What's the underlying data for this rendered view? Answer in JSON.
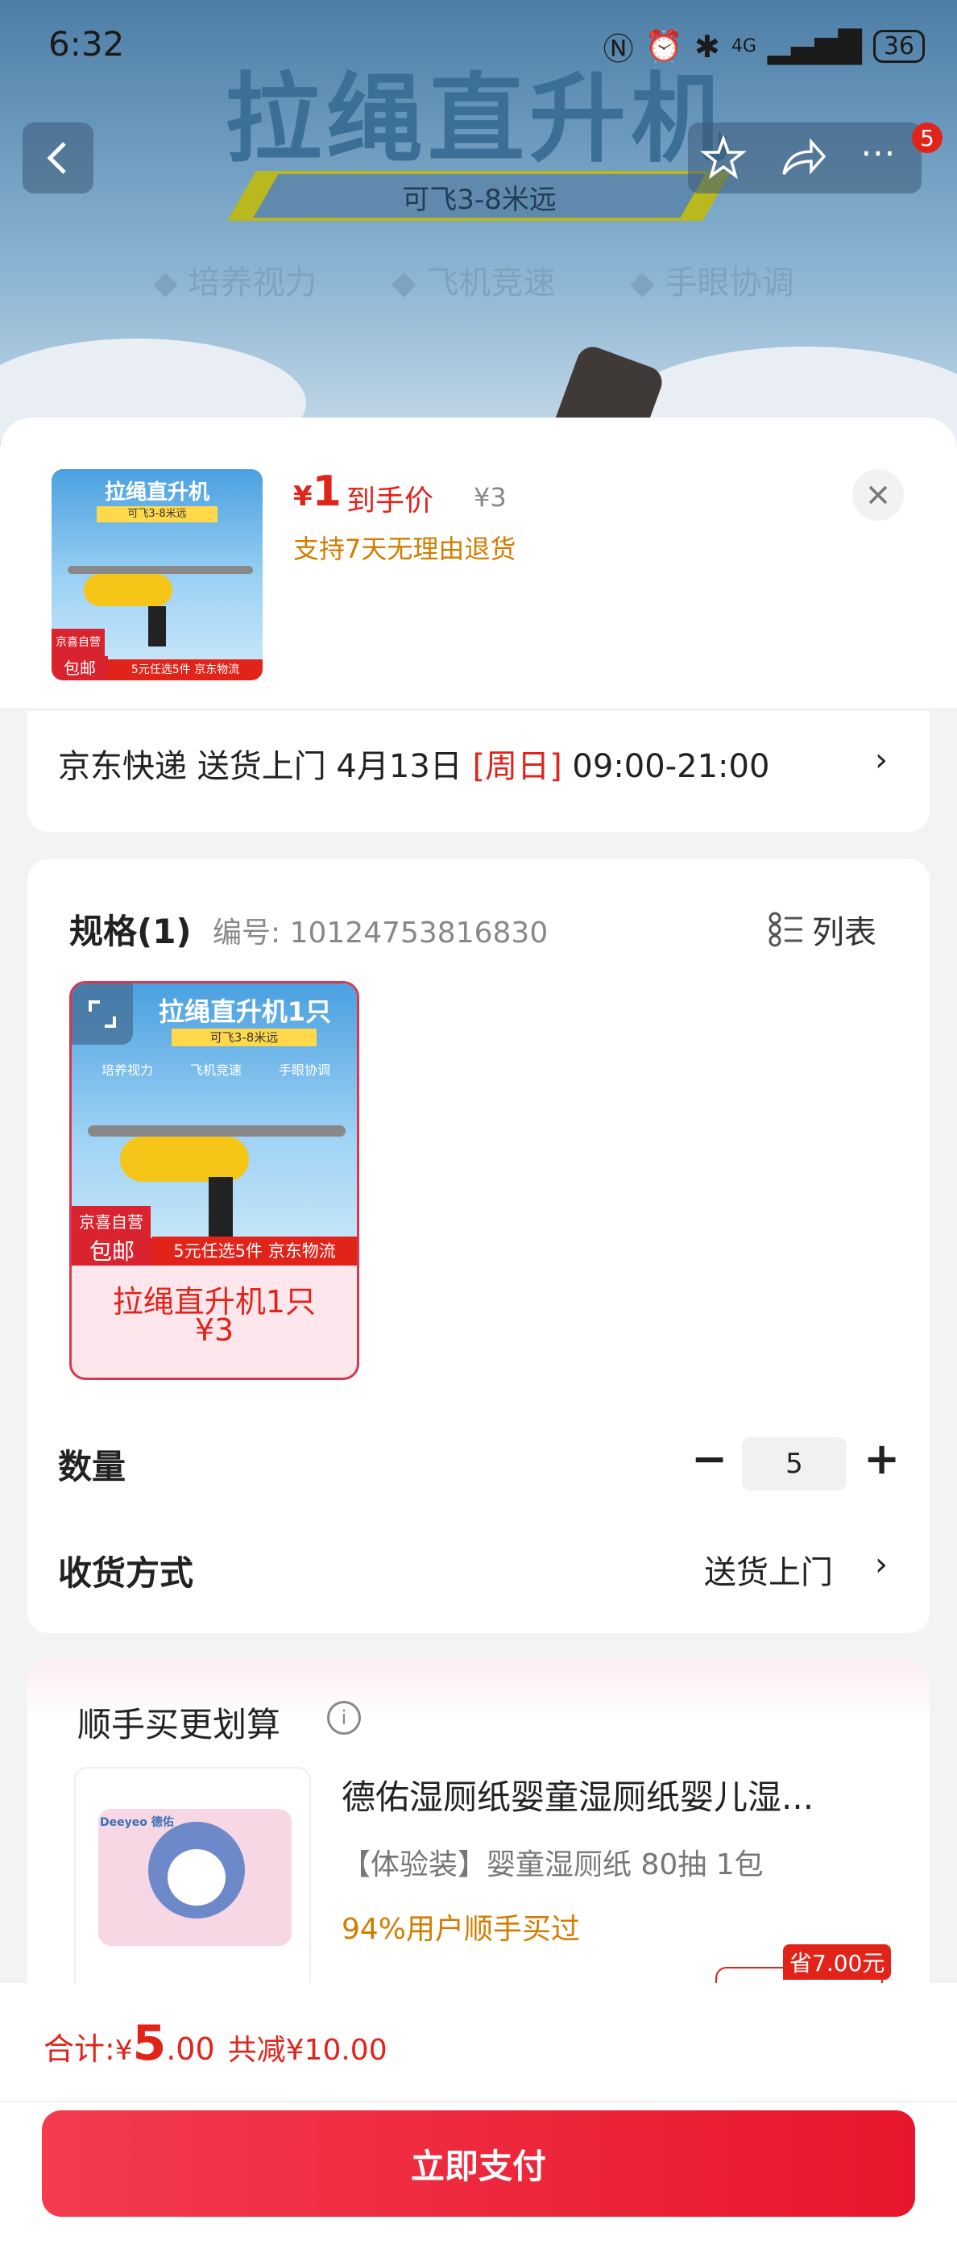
{
  "status_bar": {
    "time": "6:32",
    "network": "4G",
    "battery": "36"
  },
  "hero": {
    "title": "拉绳直升机",
    "subtitle": "可飞3-8米远",
    "features": [
      "培养视力",
      "飞机竞速",
      "手眼协调"
    ]
  },
  "top_nav": {
    "more_badge": "5"
  },
  "product": {
    "price_symbol": "¥",
    "price": "1",
    "price_label": "到手价",
    "original_price": "¥3",
    "return_policy": "支持7天无理由退货",
    "thumb_title": "拉绳直升机",
    "thumb_subtitle": "可飞3-8米远",
    "thumb_tag_top": "京喜自营",
    "thumb_tag_bottom": "包邮",
    "thumb_strip": "5元任选5件 京东物流"
  },
  "delivery": {
    "text_before": "京东快递 送货上门 4月13日 ",
    "weekday": "[周日]",
    "text_after": " 09:00-21:00"
  },
  "spec": {
    "label": "规格(1)",
    "sku_label": "编号: 10124753816830",
    "list_label": "列表",
    "option_name": "拉绳直升机1只",
    "option_price": "¥3",
    "image_features": [
      "培养视力",
      "飞机竞速",
      "手眼协调"
    ]
  },
  "quantity": {
    "label": "数量",
    "value": "5"
  },
  "shipping": {
    "label": "收货方式",
    "value": "送货上门"
  },
  "upsell": {
    "title": "顺手买更划算",
    "product_name": "德佑湿厕纸婴童湿厕纸婴儿湿...",
    "variant": "【体验装】婴童湿厕纸 80抽 1包",
    "social_proof": "94%用户顺手买过",
    "save_tag": "省7.00元",
    "brand": "Deeyeo 德佑"
  },
  "footer": {
    "total_label": "合计: ",
    "currency": "¥",
    "total_int": "5",
    "total_dec": ".00",
    "discount": "共减¥10.00",
    "pay_button": "立即支付"
  },
  "colors": {
    "accent": "#e2231a",
    "pay_gradient_start": "#f43b4f",
    "pay_gradient_end": "#e8162b"
  }
}
